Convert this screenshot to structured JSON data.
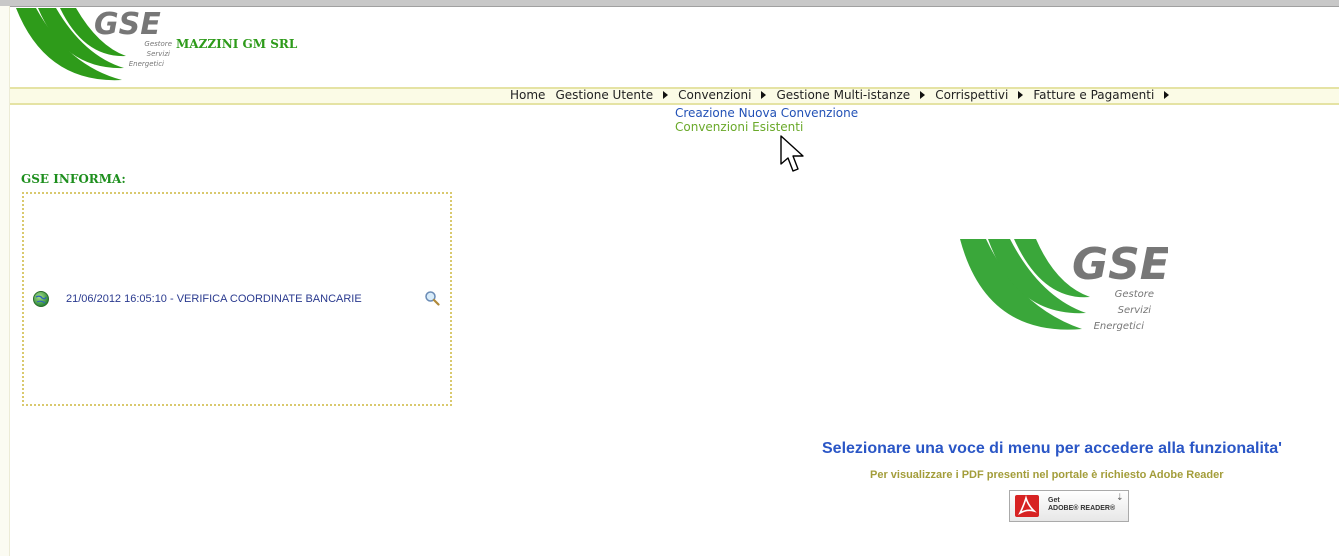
{
  "header": {
    "logo_text": "GSE",
    "logo_sub": [
      "Gestore",
      "Servizi",
      "Energetici"
    ],
    "company": "MAZZINI GM SRL"
  },
  "menu": {
    "items": [
      {
        "label": "Home",
        "has_arrow": false
      },
      {
        "label": "Gestione Utente",
        "has_arrow": true
      },
      {
        "label": "Convenzioni",
        "has_arrow": true
      },
      {
        "label": "Gestione Multi-istanze",
        "has_arrow": true
      },
      {
        "label": "Corrispettivi",
        "has_arrow": true
      },
      {
        "label": "Fatture e Pagamenti",
        "has_arrow": true
      }
    ],
    "submenu": [
      "Creazione Nuova Convenzione",
      "Convenzioni Esistenti"
    ]
  },
  "info": {
    "title": "GSE INFORMA:",
    "news": "21/06/2012 16:05:10 - VERIFICA COORDINATE BANCARIE"
  },
  "main": {
    "logo_text": "GSE",
    "logo_sub": [
      "Gestore",
      "Servizi",
      "Energetici"
    ],
    "select_msg": "Selezionare una voce di menu per accedere alla funzionalita'",
    "pdf_msg": "Per visualizzare i PDF presenti nel portale è richiesto Adobe Reader",
    "adobe_get": "Get",
    "adobe_reader": "ADOBE® READER®"
  },
  "colors": {
    "brand_green": "#2e9b1a",
    "link_blue": "#2251b6",
    "accent_yellow": "#e5e3a4"
  }
}
